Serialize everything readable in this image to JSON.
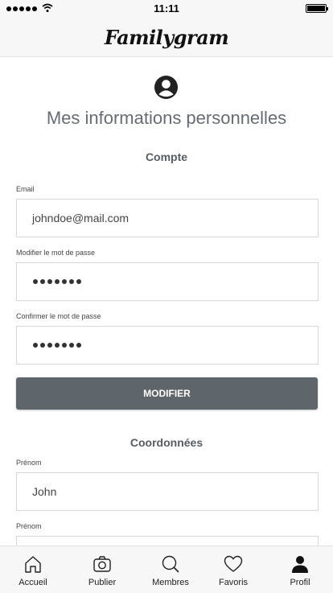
{
  "status_bar": {
    "time": "11:11",
    "signal_icon": "signal-dots-icon",
    "wifi_icon": "wifi-icon",
    "battery_icon": "battery-icon"
  },
  "header": {
    "logo_text": "Familygram"
  },
  "main": {
    "icon": "user-circle-icon",
    "title": "Mes informations personnelles",
    "account_section": {
      "title": "Compte",
      "email_label": "Email",
      "email_value": "johndoe@mail.com",
      "password_label": "Modifier le mot de passe",
      "confirm_label": "Confirmer  le mot de passe",
      "submit_label": "MODIFIER"
    },
    "contact_section": {
      "title": "Coordonnées",
      "firstname_label": "Prénom",
      "firstname_value": "John",
      "second_label": "Prénom"
    }
  },
  "tab_bar": {
    "items": [
      {
        "label": "Accueil",
        "icon": "home-icon"
      },
      {
        "label": "Publier",
        "icon": "camera-icon"
      },
      {
        "label": "Membres",
        "icon": "search-icon"
      },
      {
        "label": "Favoris",
        "icon": "heart-icon"
      },
      {
        "label": "Profil",
        "icon": "user-icon",
        "active": true
      }
    ]
  },
  "colors": {
    "button": "#5e656b",
    "title": "#666c73",
    "bars": "#f7f7f7"
  }
}
